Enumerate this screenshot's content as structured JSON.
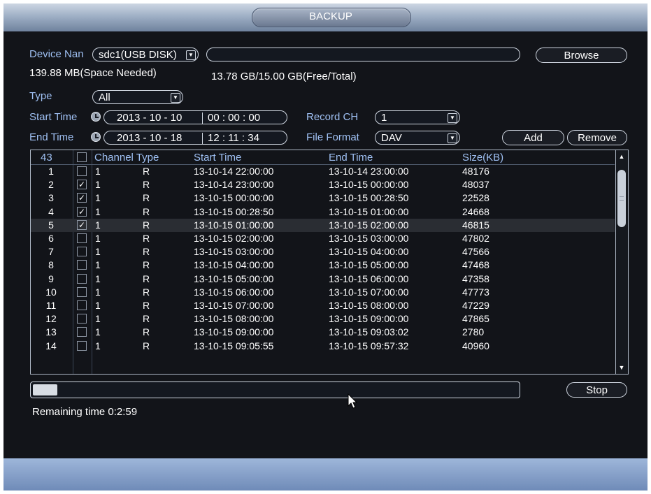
{
  "window": {
    "title": "BACKUP"
  },
  "device": {
    "label": "Device Nan",
    "selected": "sdc1(USB DISK)",
    "path_value": "",
    "browse_label": "Browse"
  },
  "space": {
    "needed": "139.88 MB(Space Needed)",
    "free_total": "13.78 GB/15.00 GB(Free/Total)"
  },
  "type": {
    "label": "Type",
    "selected": "All"
  },
  "start_time": {
    "label": "Start Time",
    "date": "2013 - 10 - 10",
    "time": "00 : 00 : 00"
  },
  "end_time": {
    "label": "End Time",
    "date": "2013 - 10 - 18",
    "time": "12 : 11 : 34"
  },
  "record_ch": {
    "label": "Record CH",
    "selected": "1"
  },
  "file_format": {
    "label": "File Format",
    "selected": "DAV"
  },
  "buttons": {
    "add": "Add",
    "remove": "Remove",
    "stop": "Stop"
  },
  "table": {
    "headers": {
      "count": "43",
      "channel_type": "Channel Type",
      "start_time": "Start Time",
      "end_time": "End Time",
      "size": "Size(KB)"
    },
    "rows": [
      {
        "index": "1",
        "checked": false,
        "channel": "1",
        "type": "R",
        "start": "13-10-14 22:00:00",
        "end": "13-10-14 23:00:00",
        "size": "48176"
      },
      {
        "index": "2",
        "checked": true,
        "channel": "1",
        "type": "R",
        "start": "13-10-14 23:00:00",
        "end": "13-10-15 00:00:00",
        "size": "48037"
      },
      {
        "index": "3",
        "checked": true,
        "channel": "1",
        "type": "R",
        "start": "13-10-15 00:00:00",
        "end": "13-10-15 00:28:50",
        "size": "22528"
      },
      {
        "index": "4",
        "checked": true,
        "channel": "1",
        "type": "R",
        "start": "13-10-15 00:28:50",
        "end": "13-10-15 01:00:00",
        "size": "24668"
      },
      {
        "index": "5",
        "checked": true,
        "channel": "1",
        "type": "R",
        "start": "13-10-15 01:00:00",
        "end": "13-10-15 02:00:00",
        "size": "46815",
        "selected": true
      },
      {
        "index": "6",
        "checked": false,
        "channel": "1",
        "type": "R",
        "start": "13-10-15 02:00:00",
        "end": "13-10-15 03:00:00",
        "size": "47802"
      },
      {
        "index": "7",
        "checked": false,
        "channel": "1",
        "type": "R",
        "start": "13-10-15 03:00:00",
        "end": "13-10-15 04:00:00",
        "size": "47566"
      },
      {
        "index": "8",
        "checked": false,
        "channel": "1",
        "type": "R",
        "start": "13-10-15 04:00:00",
        "end": "13-10-15 05:00:00",
        "size": "47468"
      },
      {
        "index": "9",
        "checked": false,
        "channel": "1",
        "type": "R",
        "start": "13-10-15 05:00:00",
        "end": "13-10-15 06:00:00",
        "size": "47358"
      },
      {
        "index": "10",
        "checked": false,
        "channel": "1",
        "type": "R",
        "start": "13-10-15 06:00:00",
        "end": "13-10-15 07:00:00",
        "size": "47773"
      },
      {
        "index": "11",
        "checked": false,
        "channel": "1",
        "type": "R",
        "start": "13-10-15 07:00:00",
        "end": "13-10-15 08:00:00",
        "size": "47229"
      },
      {
        "index": "12",
        "checked": false,
        "channel": "1",
        "type": "R",
        "start": "13-10-15 08:00:00",
        "end": "13-10-15 09:00:00",
        "size": "47865"
      },
      {
        "index": "13",
        "checked": false,
        "channel": "1",
        "type": "R",
        "start": "13-10-15 09:00:00",
        "end": "13-10-15 09:03:02",
        "size": "2780"
      },
      {
        "index": "14",
        "checked": false,
        "channel": "1",
        "type": "R",
        "start": "13-10-15 09:05:55",
        "end": "13-10-15 09:57:32",
        "size": "40960"
      }
    ]
  },
  "progress": {
    "fraction": 0.05
  },
  "remaining": "Remaining time 0:2:59",
  "colors": {
    "label_blue": "#9fc0f3",
    "background": "#121419",
    "selected_row": "#2a2d33"
  }
}
